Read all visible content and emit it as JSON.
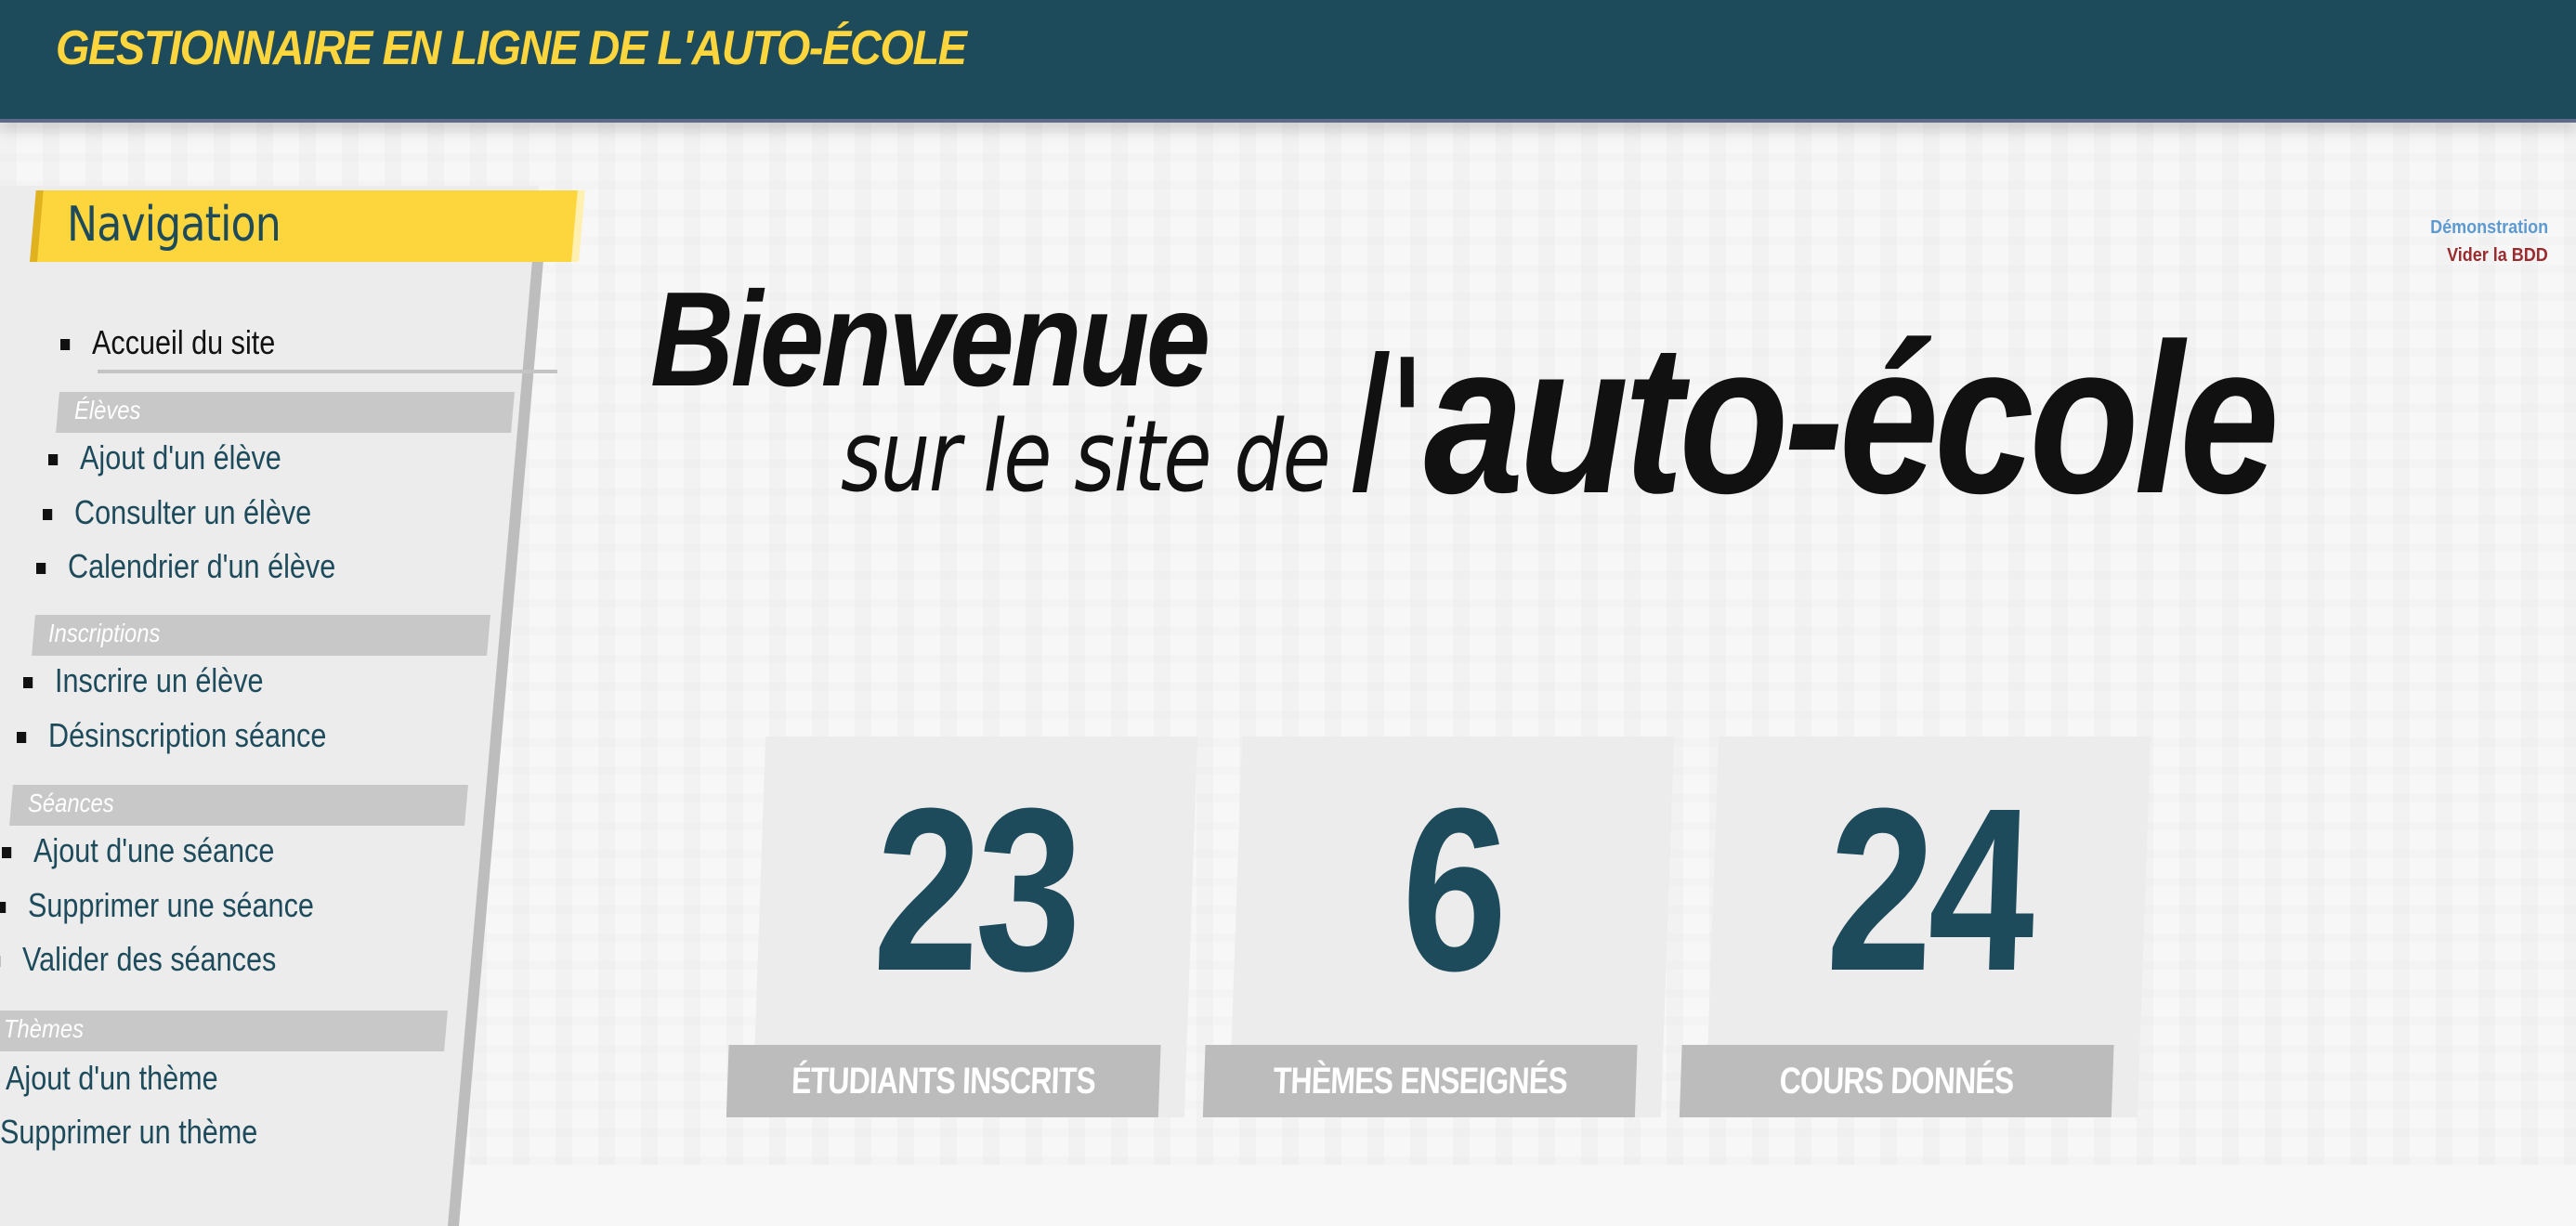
{
  "header": {
    "title": "GESTIONNAIRE EN LIGNE DE L'AUTO-ÉCOLE"
  },
  "sidebar": {
    "title": "Navigation",
    "home": "Accueil du site",
    "sections": [
      {
        "label": "Élèves",
        "items": [
          "Ajout d'un élève",
          "Consulter un élève",
          "Calendrier d'un élève"
        ]
      },
      {
        "label": "Inscriptions",
        "items": [
          "Inscrire un élève",
          "Désinscription séance"
        ]
      },
      {
        "label": "Séances",
        "items": [
          "Ajout d'une séance",
          "Supprimer une séance",
          "Valider des séances"
        ]
      },
      {
        "label": "Thèmes",
        "items": [
          "Ajout d'un thème",
          "Supprimer un thème"
        ]
      }
    ]
  },
  "links": {
    "demo": "Démonstration",
    "clear": "Vider la BDD"
  },
  "hero": {
    "line1": "Bienvenue",
    "line2": "sur le site de",
    "apostrophe": "l'",
    "school": "auto-école"
  },
  "stats": [
    {
      "value": "23",
      "label": "ÉTUDIANTS INSCRITS"
    },
    {
      "value": "6",
      "label": "THÈMES ENSEIGNÉS"
    },
    {
      "value": "24",
      "label": "COURS DONNÉS"
    }
  ],
  "colors": {
    "header_bg": "#1e4b5b",
    "accent_yellow": "#fdd53c",
    "number_teal": "#1e4b5b",
    "link_blue": "#5d9ad0",
    "link_red": "#9a2b2f"
  }
}
